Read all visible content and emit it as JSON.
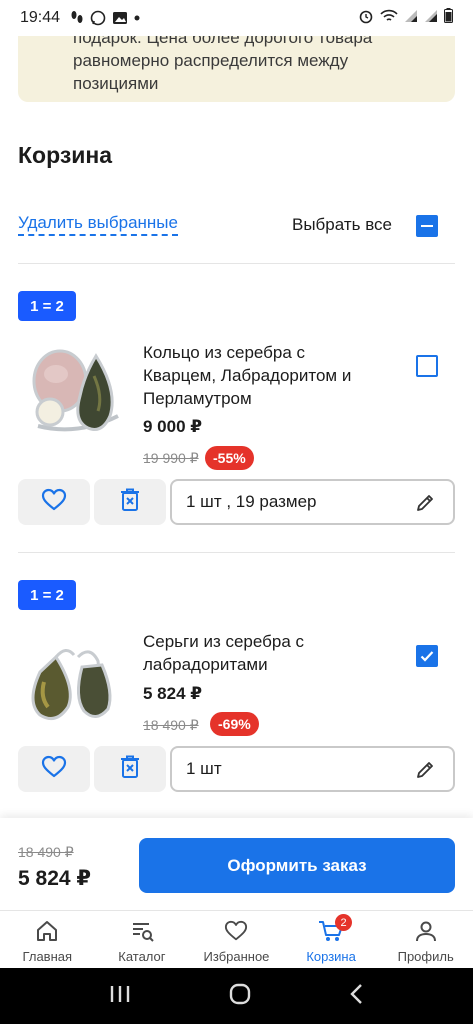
{
  "status_bar": {
    "time": "19:44"
  },
  "notice": {
    "lines": [
      "подарок. Цена более дорогого товара",
      "равномерно распределится между",
      "позициями"
    ]
  },
  "cart": {
    "title": "Корзина",
    "delete_selected": "Удалить выбранные",
    "select_all": "Выбрать все"
  },
  "items": [
    {
      "badge": "1 = 2",
      "name_lines": [
        "Кольцо из серебра с",
        "Кварцем, Лабрадоритом и",
        "Перламутром"
      ],
      "price": "9 000 ₽",
      "old_price": "19 990 ₽",
      "discount": "-55%",
      "options": "1 шт , 19 размер",
      "checked": false
    },
    {
      "badge": "1 = 2",
      "name_lines": [
        "Серьги из серебра с",
        "лабрадоритами"
      ],
      "price": "5 824 ₽",
      "old_price": "18 490 ₽",
      "discount": "-69%",
      "options": "1 шт",
      "checked": true
    }
  ],
  "checkout": {
    "old_total": "18 490 ₽",
    "total": "5 824 ₽",
    "button": "Оформить заказ"
  },
  "tabs": [
    {
      "label": "Главная",
      "icon": "home-icon"
    },
    {
      "label": "Каталог",
      "icon": "catalog-icon"
    },
    {
      "label": "Избранное",
      "icon": "heart-icon"
    },
    {
      "label": "Корзина",
      "icon": "cart-icon",
      "badge": "2",
      "active": true
    },
    {
      "label": "Профиль",
      "icon": "profile-icon"
    }
  ],
  "colors": {
    "accent": "#1a73e8",
    "badge": "#1a5bff",
    "discount": "#e5332a",
    "notice_bg": "#f5f1dd"
  }
}
